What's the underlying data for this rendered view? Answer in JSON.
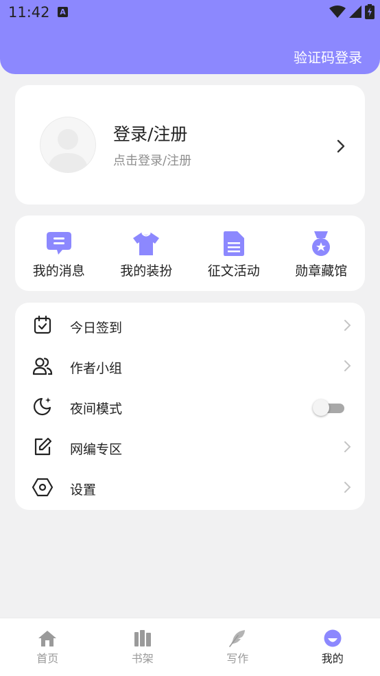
{
  "status_bar": {
    "time": "11:42",
    "indicator": "A"
  },
  "header": {
    "verify_login": "验证码登录"
  },
  "profile": {
    "name": "登录/注册",
    "subtitle": "点击登录/注册"
  },
  "quick_actions": [
    {
      "label": "我的消息",
      "icon": "message-icon"
    },
    {
      "label": "我的装扮",
      "icon": "tshirt-icon"
    },
    {
      "label": "征文活动",
      "icon": "document-icon"
    },
    {
      "label": "勋章藏馆",
      "icon": "medal-icon"
    }
  ],
  "menu": [
    {
      "label": "今日签到",
      "icon": "calendar-check-icon"
    },
    {
      "label": "作者小组",
      "icon": "group-icon"
    },
    {
      "label": "夜间模式",
      "icon": "moon-icon",
      "toggle_on": false
    },
    {
      "label": "网编专区",
      "icon": "edit-icon"
    },
    {
      "label": "设置",
      "icon": "settings-icon"
    }
  ],
  "tabs": [
    {
      "label": "首页",
      "icon": "home-icon"
    },
    {
      "label": "书架",
      "icon": "bookshelf-icon"
    },
    {
      "label": "写作",
      "icon": "feather-icon"
    },
    {
      "label": "我的",
      "icon": "profile-icon",
      "active": true
    }
  ],
  "colors": {
    "accent": "#8c88fe",
    "background": "#f1f1f2"
  }
}
